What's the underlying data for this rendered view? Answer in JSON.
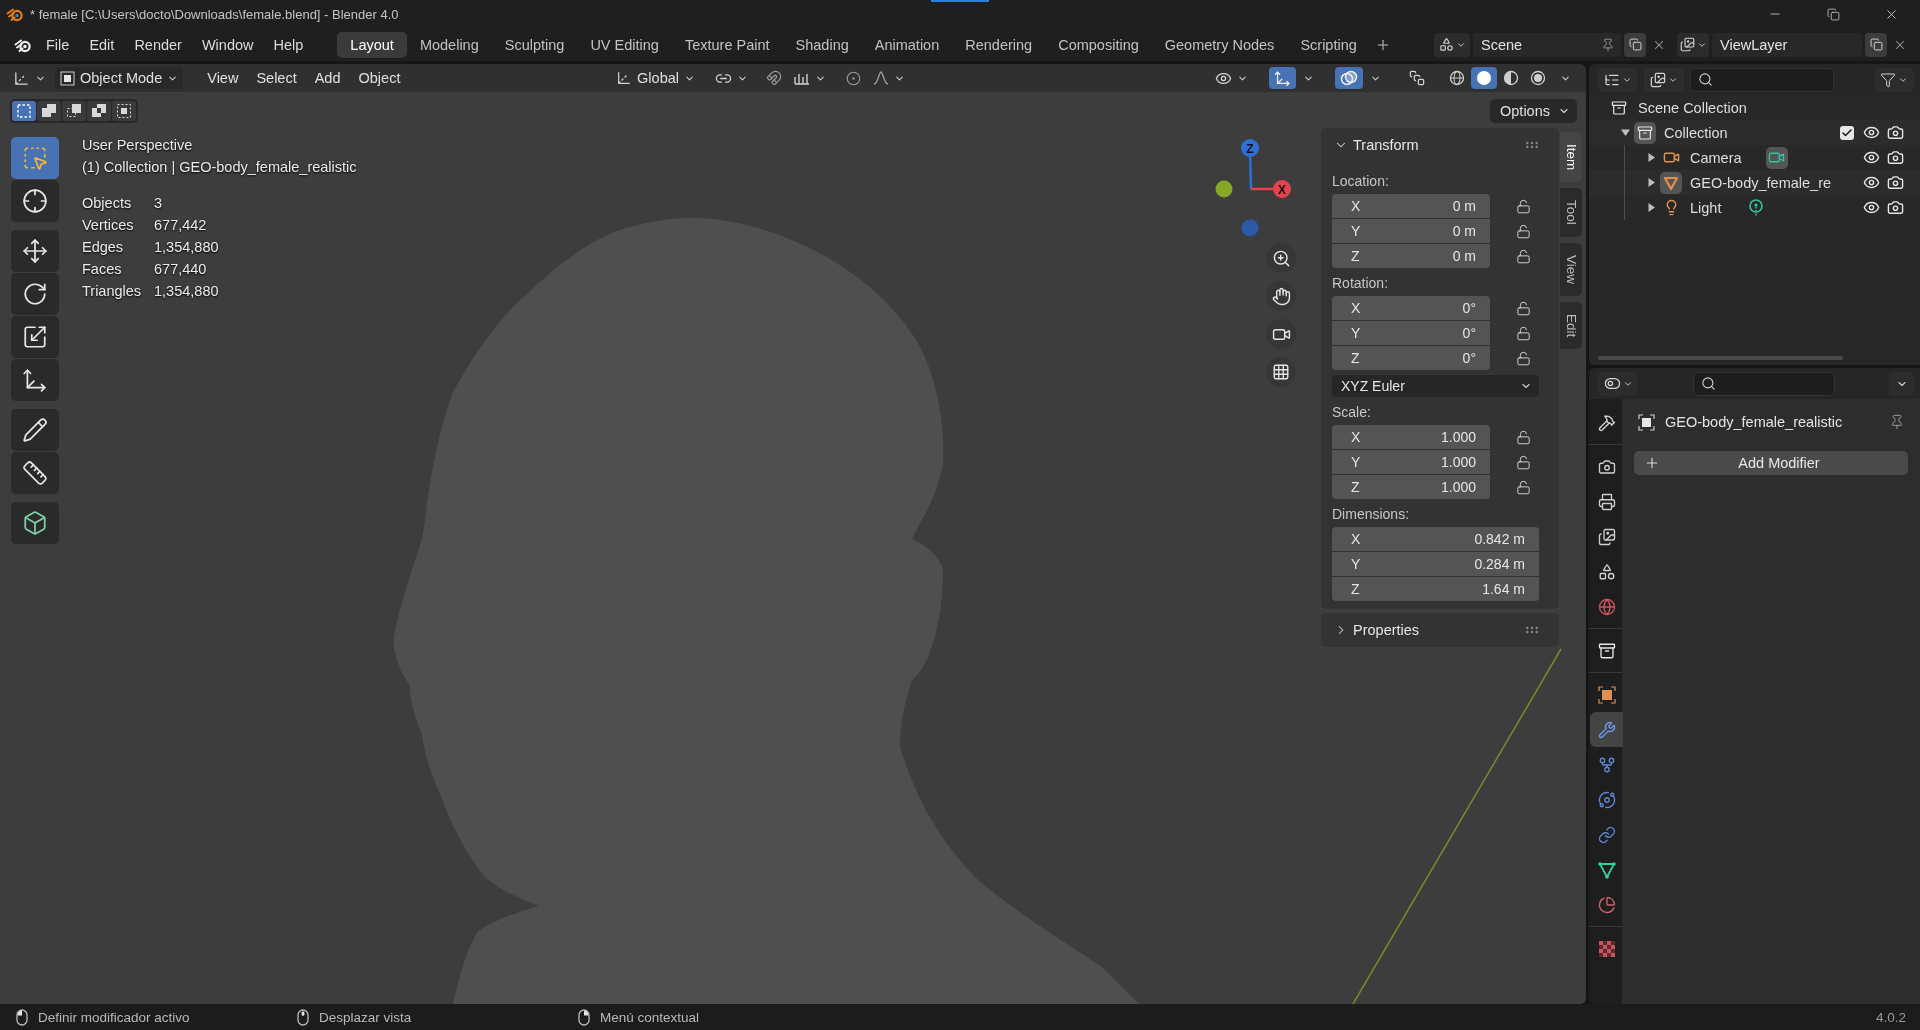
{
  "title_bar": {
    "title": "* female [C:\\Users\\docto\\Downloads\\female.blend] - Blender 4.0"
  },
  "menu_bar": {
    "menus": [
      "File",
      "Edit",
      "Render",
      "Window",
      "Help"
    ],
    "workspaces": [
      {
        "label": "Layout",
        "selected": true
      },
      {
        "label": "Modeling",
        "selected": false
      },
      {
        "label": "Sculpting",
        "selected": false
      },
      {
        "label": "UV Editing",
        "selected": false
      },
      {
        "label": "Texture Paint",
        "selected": false
      },
      {
        "label": "Shading",
        "selected": false
      },
      {
        "label": "Animation",
        "selected": false
      },
      {
        "label": "Rendering",
        "selected": false
      },
      {
        "label": "Compositing",
        "selected": false
      },
      {
        "label": "Geometry Nodes",
        "selected": false
      },
      {
        "label": "Scripting",
        "selected": false
      }
    ],
    "scene": "Scene",
    "view_layer": "ViewLayer"
  },
  "viewport_header": {
    "mode": "Object Mode",
    "menus": [
      "View",
      "Select",
      "Add",
      "Object"
    ],
    "orientation": "Global",
    "snap": false,
    "proportional_editing": false,
    "show_gizmos": true,
    "show_overlays": true,
    "xray": false,
    "shading": [
      {
        "kind": "wireframe",
        "selected": false
      },
      {
        "kind": "solid",
        "selected": true
      },
      {
        "kind": "material",
        "selected": false
      },
      {
        "kind": "rendered",
        "selected": false
      }
    ]
  },
  "viewport": {
    "select_modes": [
      {
        "kind": "new",
        "selected": true
      },
      {
        "kind": "extend",
        "selected": false
      },
      {
        "kind": "subtract",
        "selected": false
      },
      {
        "kind": "difference",
        "selected": false
      },
      {
        "kind": "intersect",
        "selected": false
      }
    ],
    "options": "Options",
    "tools": [
      {
        "kind": "select_box",
        "selected": true
      },
      {
        "kind": "cursor",
        "selected": false
      },
      {
        "kind": "move",
        "selected": false
      },
      {
        "kind": "rotate",
        "selected": false
      },
      {
        "kind": "scale",
        "selected": false
      },
      {
        "kind": "transform",
        "selected": false
      },
      {
        "kind": "annotate",
        "selected": false
      },
      {
        "kind": "measure",
        "selected": false
      },
      {
        "kind": "add_cube",
        "selected": false
      }
    ],
    "view_name": "User Perspective",
    "context": "(1) Collection | GEO-body_female_realistic",
    "stats": [
      {
        "label": "Objects",
        "value": "3"
      },
      {
        "label": "Vertices",
        "value": "677,442"
      },
      {
        "label": "Edges",
        "value": "1,354,880"
      },
      {
        "label": "Faces",
        "value": "677,440"
      },
      {
        "label": "Triangles",
        "value": "1,354,880"
      }
    ],
    "gizmo": {
      "axes": [
        {
          "label": "Z",
          "color": "#2f6fd8"
        },
        {
          "label": "X",
          "color": "#e8414e"
        }
      ],
      "dots": [
        {
          "color": "#86a626"
        },
        {
          "color": "#2c5aa6"
        }
      ]
    }
  },
  "sidebar": {
    "tabs": [
      {
        "label": "Item",
        "selected": true
      },
      {
        "label": "Tool",
        "selected": false
      },
      {
        "label": "View",
        "selected": false
      },
      {
        "label": "Edit",
        "selected": false
      }
    ],
    "panels": [
      {
        "title": "Transform",
        "expanded": true,
        "groups": [
          {
            "label": "Location:",
            "fields": [
              {
                "axis": "X",
                "value": "0 m",
                "locked": false
              },
              {
                "axis": "Y",
                "value": "0 m",
                "locked": false
              },
              {
                "axis": "Z",
                "value": "0 m",
                "locked": false
              }
            ]
          },
          {
            "label": "Rotation:",
            "fields": [
              {
                "axis": "X",
                "value": "0°",
                "locked": false
              },
              {
                "axis": "Y",
                "value": "0°",
                "locked": false
              },
              {
                "axis": "Z",
                "value": "0°",
                "locked": false
              }
            ],
            "mode": "XYZ Euler"
          },
          {
            "label": "Scale:",
            "fields": [
              {
                "axis": "X",
                "value": "1.000",
                "locked": false
              },
              {
                "axis": "Y",
                "value": "1.000",
                "locked": false
              },
              {
                "axis": "Z",
                "value": "1.000",
                "locked": false
              }
            ]
          },
          {
            "label": "Dimensions:",
            "fields": [
              {
                "axis": "X",
                "value": "0.842 m"
              },
              {
                "axis": "Y",
                "value": "0.284 m"
              },
              {
                "axis": "Z",
                "value": "1.64 m"
              }
            ]
          }
        ]
      },
      {
        "title": "Properties",
        "expanded": false
      }
    ]
  },
  "outliner": {
    "tree": [
      {
        "label": "Scene Collection",
        "kind": "scene_collection",
        "children": [
          {
            "label": "Collection",
            "kind": "collection",
            "expanded": true,
            "active": true,
            "included": true,
            "visible": true,
            "renderable": true,
            "children": [
              {
                "label": "Camera",
                "kind": "camera",
                "expanded": false,
                "active": false,
                "data": {
                  "kind": "camera",
                  "active": true
                },
                "visible": true,
                "renderable": true
              },
              {
                "label": "GEO-body_female_re",
                "kind": "mesh",
                "expanded": false,
                "active": true,
                "visible": true,
                "renderable": true
              },
              {
                "label": "Light",
                "kind": "light",
                "expanded": false,
                "active": false,
                "data": {
                  "kind": "light",
                  "active": false
                },
                "visible": true,
                "renderable": true
              }
            ]
          }
        ]
      }
    ]
  },
  "properties": {
    "tabs": [
      {
        "kind": "tool",
        "selected": false
      },
      {
        "kind": "render",
        "selected": false
      },
      {
        "kind": "output",
        "selected": false
      },
      {
        "kind": "view_layer",
        "selected": false
      },
      {
        "kind": "scene",
        "selected": false
      },
      {
        "kind": "world",
        "selected": false
      },
      {
        "kind": "collection",
        "selected": false
      },
      {
        "kind": "object",
        "selected": false
      },
      {
        "kind": "modifiers",
        "selected": true
      },
      {
        "kind": "particles",
        "selected": false
      },
      {
        "kind": "physics",
        "selected": false
      },
      {
        "kind": "constraints",
        "selected": false
      },
      {
        "kind": "data",
        "selected": false
      },
      {
        "kind": "material",
        "selected": false
      },
      {
        "kind": "texture",
        "selected": false
      }
    ],
    "object_name": "GEO-body_female_realistic",
    "add_button": "Add Modifier"
  },
  "status_bar": {
    "hints": [
      {
        "kind": "left",
        "text": "Definir modificador activo"
      },
      {
        "kind": "middle",
        "text": "Desplazar vista"
      },
      {
        "kind": "right",
        "text": "Menú contextual"
      }
    ],
    "version": "4.0.2"
  }
}
